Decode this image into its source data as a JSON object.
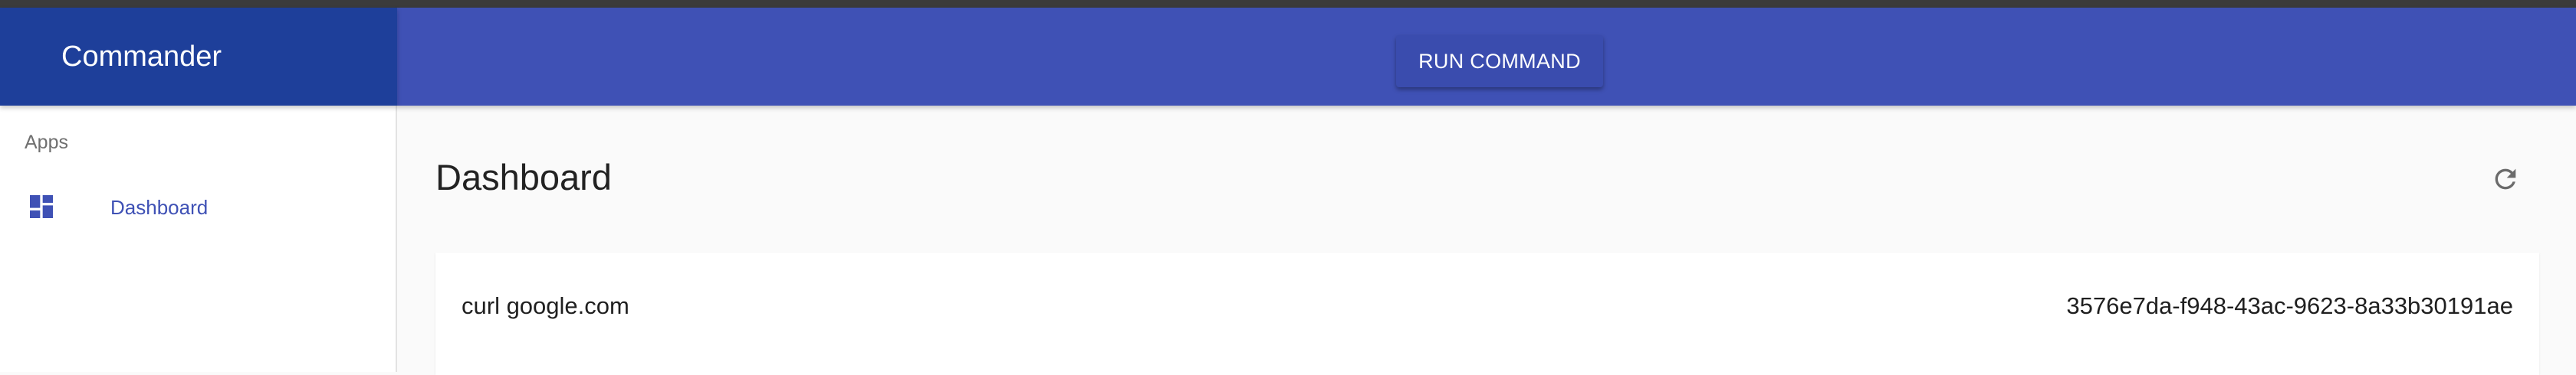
{
  "app": {
    "title": "Commander"
  },
  "appbar": {
    "run_command_label": "RUN COMMAND"
  },
  "sidebar": {
    "section_label": "Apps",
    "items": [
      {
        "label": "Dashboard",
        "icon": "dashboard-icon",
        "active": true
      }
    ]
  },
  "main": {
    "page_title": "Dashboard",
    "refresh_icon": "refresh-icon",
    "commands": [
      {
        "command": "curl google.com",
        "id": "3576e7da-f948-43ac-9623-8a33b30191ae"
      }
    ]
  },
  "colors": {
    "primary": "#3f51b5",
    "primary_dark": "#1e3f9a",
    "background": "#fafafa",
    "top_strip": "#3b3b3b"
  }
}
